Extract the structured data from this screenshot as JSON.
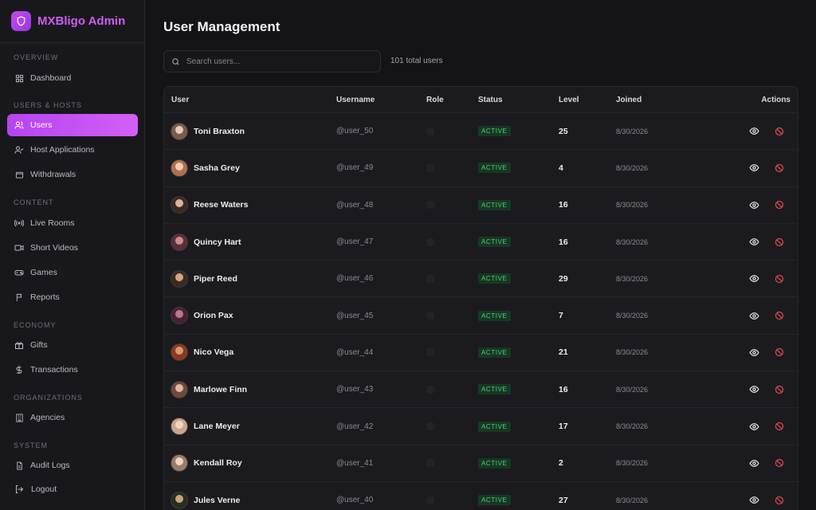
{
  "brand": {
    "title": "MXBligo Admin"
  },
  "sidebar": {
    "sections": [
      {
        "label": "OVERVIEW"
      },
      {
        "label": "USERS & HOSTS"
      },
      {
        "label": "CONTENT"
      },
      {
        "label": "ECONOMY"
      },
      {
        "label": "ORGANIZATIONS"
      },
      {
        "label": "SYSTEM"
      }
    ],
    "items": [
      {
        "label": "Dashboard",
        "icon": "dashboard-icon"
      },
      {
        "label": "Users",
        "icon": "users-icon",
        "active": true
      },
      {
        "label": "Host Applications",
        "icon": "user-check-icon"
      },
      {
        "label": "Withdrawals",
        "icon": "wallet-icon"
      },
      {
        "label": "Live Rooms",
        "icon": "broadcast-icon"
      },
      {
        "label": "Short Videos",
        "icon": "video-icon"
      },
      {
        "label": "Games",
        "icon": "gamepad-icon"
      },
      {
        "label": "Reports",
        "icon": "flag-icon"
      },
      {
        "label": "Gifts",
        "icon": "gift-icon"
      },
      {
        "label": "Transactions",
        "icon": "dollar-icon"
      },
      {
        "label": "Agencies",
        "icon": "building-icon"
      },
      {
        "label": "Audit Logs",
        "icon": "file-icon"
      }
    ],
    "logout_label": "Logout"
  },
  "main": {
    "title": "User Management",
    "search": {
      "placeholder": "Search users..."
    },
    "total_users": "101 total users",
    "table": {
      "columns": [
        "User",
        "Username",
        "Role",
        "Status",
        "Level",
        "Joined",
        "Actions"
      ],
      "rows": [
        {
          "name": "Toni Braxton",
          "username": "@user_50",
          "status": "ACTIVE",
          "level": "25",
          "joined": "8/30/2026"
        },
        {
          "name": "Sasha Grey",
          "username": "@user_49",
          "status": "ACTIVE",
          "level": "4",
          "joined": "8/30/2026"
        },
        {
          "name": "Reese Waters",
          "username": "@user_48",
          "status": "ACTIVE",
          "level": "16",
          "joined": "8/30/2026"
        },
        {
          "name": "Quincy Hart",
          "username": "@user_47",
          "status": "ACTIVE",
          "level": "16",
          "joined": "8/30/2026"
        },
        {
          "name": "Piper Reed",
          "username": "@user_46",
          "status": "ACTIVE",
          "level": "29",
          "joined": "8/30/2026"
        },
        {
          "name": "Orion Pax",
          "username": "@user_45",
          "status": "ACTIVE",
          "level": "7",
          "joined": "8/30/2026"
        },
        {
          "name": "Nico Vega",
          "username": "@user_44",
          "status": "ACTIVE",
          "level": "21",
          "joined": "8/30/2026"
        },
        {
          "name": "Marlowe Finn",
          "username": "@user_43",
          "status": "ACTIVE",
          "level": "16",
          "joined": "8/30/2026"
        },
        {
          "name": "Lane Meyer",
          "username": "@user_42",
          "status": "ACTIVE",
          "level": "17",
          "joined": "8/30/2026"
        },
        {
          "name": "Kendall Roy",
          "username": "@user_41",
          "status": "ACTIVE",
          "level": "2",
          "joined": "8/30/2026"
        },
        {
          "name": "Jules Verne",
          "username": "@user_40",
          "status": "ACTIVE",
          "level": "27",
          "joined": "8/30/2026"
        }
      ]
    }
  },
  "colors": {
    "accent": "#c04bf2",
    "status_active": "#4fcf7b",
    "danger": "#e5484d"
  }
}
